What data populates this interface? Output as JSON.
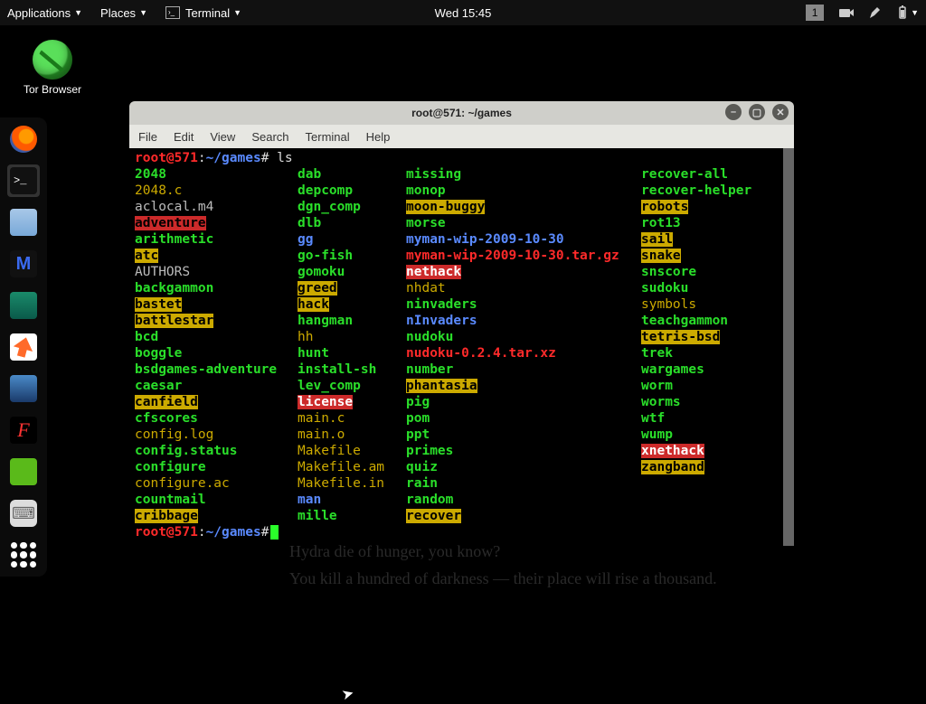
{
  "panel": {
    "apps": "Applications",
    "places": "Places",
    "terminal": "Terminal",
    "clock": "Wed 15:45",
    "workspace": "1"
  },
  "desktop": {
    "tor": "Tor Browser"
  },
  "window": {
    "title": "root@571: ~/games",
    "menu": [
      "File",
      "Edit",
      "View",
      "Search",
      "Terminal",
      "Help"
    ]
  },
  "prompt": {
    "user": "root@571",
    "sep": ":",
    "path": "~/games",
    "hash": "#",
    "cmd": "ls"
  },
  "listing": {
    "rows": [
      [
        [
          "2048",
          "greenB"
        ],
        [
          "dab",
          "greenB"
        ],
        [
          "missing",
          "greenB"
        ],
        [
          "recover-all",
          "greenB"
        ]
      ],
      [
        [
          "2048.c",
          "yellow"
        ],
        [
          "depcomp",
          "greenB"
        ],
        [
          "monop",
          "greenB"
        ],
        [
          "recover-helper",
          "greenB"
        ]
      ],
      [
        [
          "aclocal.m4",
          "grey"
        ],
        [
          "dgn_comp",
          "greenB"
        ],
        [
          "moon-buggy",
          "hl-y"
        ],
        [
          "robots",
          "hl-y"
        ]
      ],
      [
        [
          "adventure",
          "hl-rb"
        ],
        [
          "dlb",
          "greenB"
        ],
        [
          "morse",
          "greenB"
        ],
        [
          "rot13",
          "greenB"
        ]
      ],
      [
        [
          "arithmetic",
          "greenB"
        ],
        [
          "gg",
          "blueB"
        ],
        [
          "myman-wip-2009-10-30",
          "blueB"
        ],
        [
          "sail",
          "hl-y"
        ]
      ],
      [
        [
          "atc",
          "hl-y"
        ],
        [
          "go-fish",
          "greenB"
        ],
        [
          "myman-wip-2009-10-30.tar.gz",
          "redB"
        ],
        [
          "snake",
          "hl-y"
        ]
      ],
      [
        [
          "AUTHORS",
          "grey"
        ],
        [
          "gomoku",
          "greenB"
        ],
        [
          "nethack",
          "hl-r"
        ],
        [
          "snscore",
          "greenB"
        ]
      ],
      [
        [
          "backgammon",
          "greenB"
        ],
        [
          "greed",
          "hl-y"
        ],
        [
          "nhdat",
          "yellow"
        ],
        [
          "sudoku",
          "greenB"
        ]
      ],
      [
        [
          "bastet",
          "hl-y"
        ],
        [
          "hack",
          "hl-y"
        ],
        [
          "ninvaders",
          "greenB"
        ],
        [
          "symbols",
          "yellow"
        ]
      ],
      [
        [
          "battlestar",
          "hl-y"
        ],
        [
          "hangman",
          "greenB"
        ],
        [
          "nInvaders",
          "blueB"
        ],
        [
          "teachgammon",
          "greenB"
        ]
      ],
      [
        [
          "bcd",
          "greenB"
        ],
        [
          "hh",
          "yellow"
        ],
        [
          "nudoku",
          "greenB"
        ],
        [
          "tetris-bsd",
          "hl-y"
        ]
      ],
      [
        [
          "boggle",
          "greenB"
        ],
        [
          "hunt",
          "greenB"
        ],
        [
          "nudoku-0.2.4.tar.xz",
          "redB"
        ],
        [
          "trek",
          "greenB"
        ]
      ],
      [
        [
          "bsdgames-adventure",
          "greenB"
        ],
        [
          "install-sh",
          "greenB"
        ],
        [
          "number",
          "greenB"
        ],
        [
          "wargames",
          "greenB"
        ]
      ],
      [
        [
          "caesar",
          "greenB"
        ],
        [
          "lev_comp",
          "greenB"
        ],
        [
          "phantasia",
          "hl-y"
        ],
        [
          "worm",
          "greenB"
        ]
      ],
      [
        [
          "canfield",
          "hl-y"
        ],
        [
          "license",
          "hl-r"
        ],
        [
          "pig",
          "greenB"
        ],
        [
          "worms",
          "greenB"
        ]
      ],
      [
        [
          "cfscores",
          "greenB"
        ],
        [
          "main.c",
          "yellow"
        ],
        [
          "pom",
          "greenB"
        ],
        [
          "wtf",
          "greenB"
        ]
      ],
      [
        [
          "config.log",
          "yellow"
        ],
        [
          "main.o",
          "yellow"
        ],
        [
          "ppt",
          "greenB"
        ],
        [
          "wump",
          "greenB"
        ]
      ],
      [
        [
          "config.status",
          "greenB"
        ],
        [
          "Makefile",
          "yellow"
        ],
        [
          "primes",
          "greenB"
        ],
        [
          "xnethack",
          "hl-r"
        ]
      ],
      [
        [
          "configure",
          "greenB"
        ],
        [
          "Makefile.am",
          "yellow"
        ],
        [
          "quiz",
          "greenB"
        ],
        [
          "zangband",
          "hl-y"
        ]
      ],
      [
        [
          "configure.ac",
          "yellow"
        ],
        [
          "Makefile.in",
          "yellow"
        ],
        [
          "rain",
          "greenB"
        ],
        [
          "",
          ""
        ]
      ],
      [
        [
          "countmail",
          "greenB"
        ],
        [
          "man",
          "blueB"
        ],
        [
          "random",
          "greenB"
        ],
        [
          "",
          ""
        ]
      ],
      [
        [
          "cribbage",
          "hl-y"
        ],
        [
          "mille",
          "greenB"
        ],
        [
          "recover",
          "hl-y"
        ],
        [
          "",
          ""
        ]
      ]
    ]
  },
  "bg_quotes": [
    "Hydra die of hunger, you know?",
    "You kill a hundred of darkness — their place will rise a thousand."
  ]
}
